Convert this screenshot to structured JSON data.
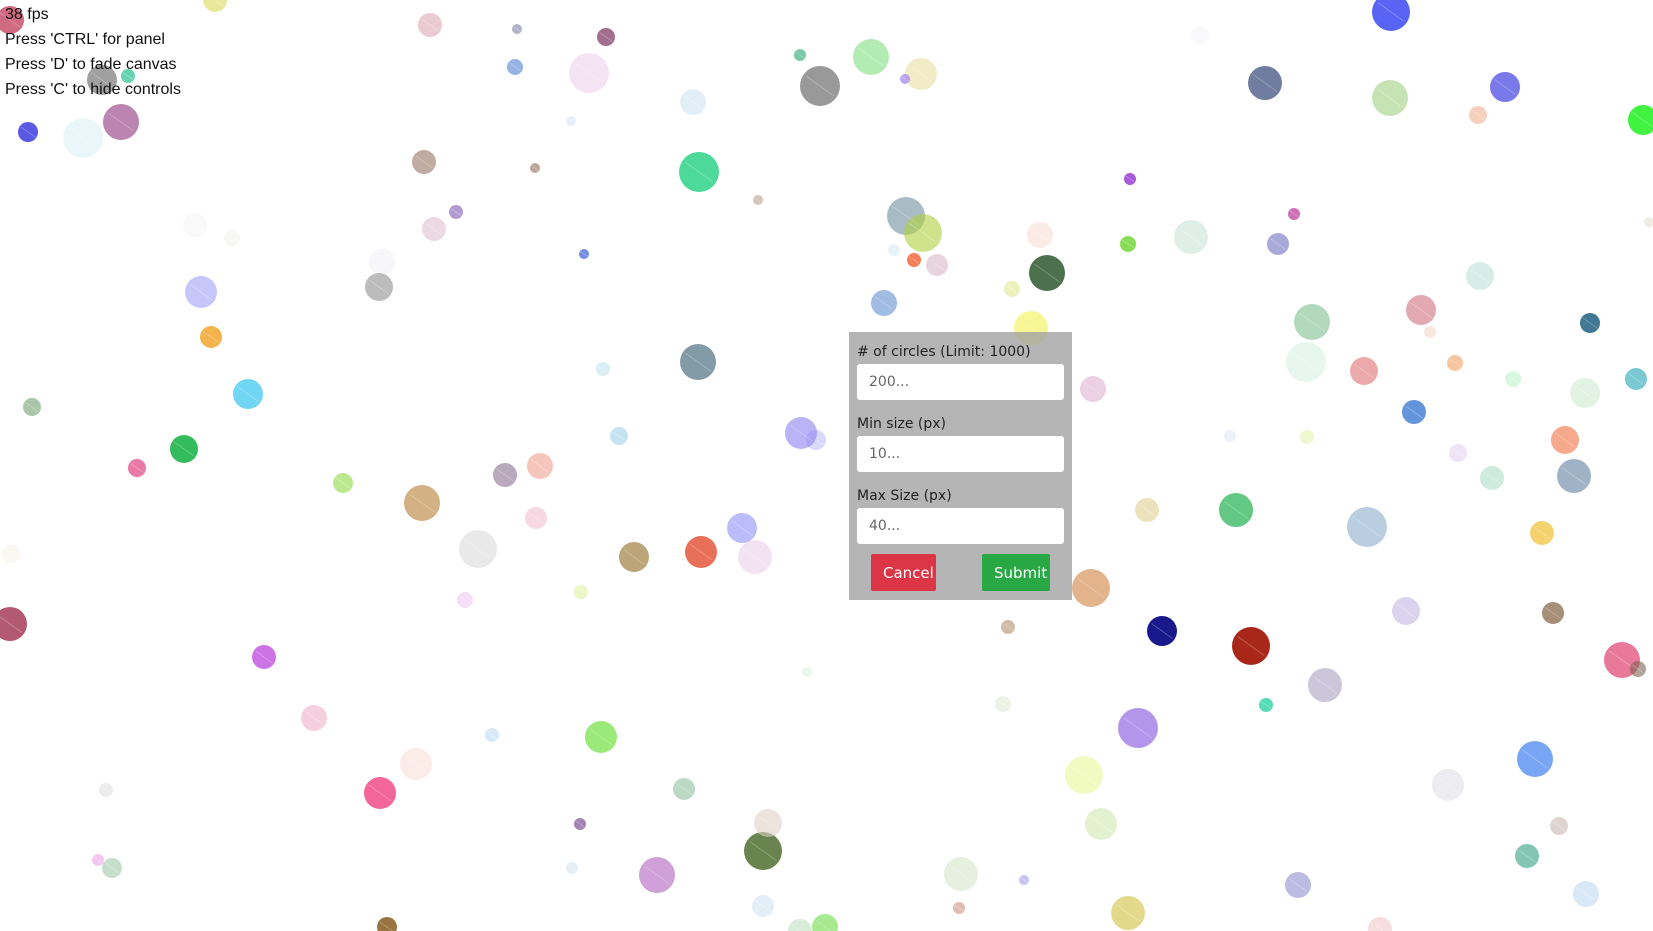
{
  "hud": {
    "fps": "38 fps",
    "line_panel": "Press 'CTRL' for panel",
    "line_fade": "Press 'D' to fade canvas",
    "line_hide": "Press 'C' to hide controls"
  },
  "panel": {
    "circles_label": "# of circles (Limit: 1000)",
    "circles_placeholder": "200...",
    "min_label": "Min size (px)",
    "min_placeholder": "10...",
    "max_label": "Max Size (px)",
    "max_placeholder": "40...",
    "cancel_label": "Cancel",
    "submit_label": "Submit"
  },
  "colors": {
    "cancel": "#dc3545",
    "submit": "#28a745",
    "panel_bg": "#a0a0a0"
  }
}
